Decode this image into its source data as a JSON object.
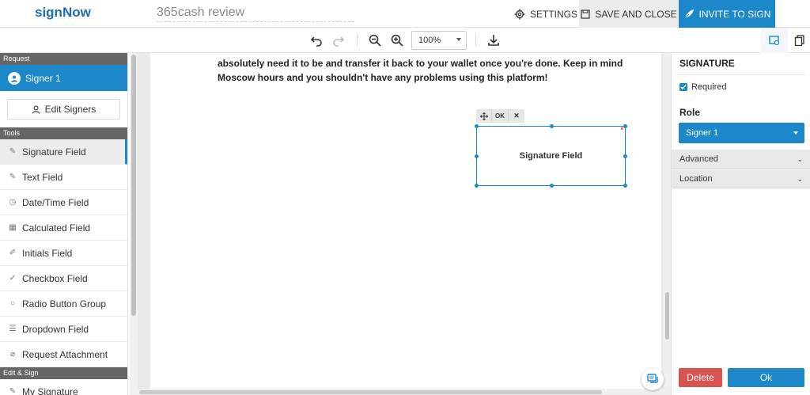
{
  "app": {
    "logo": "signNow",
    "document_title": "365cash review"
  },
  "header": {
    "settings_label": "SETTINGS",
    "save_label": "SAVE AND CLOSE",
    "invite_label": "INVITE TO SIGN"
  },
  "toolbar": {
    "zoom_value": "100%"
  },
  "sidebar": {
    "request_heading": "Request",
    "signer_name": "Signer 1",
    "edit_signers_label": "Edit Signers",
    "tools_heading": "Tools",
    "tools": [
      {
        "label": "Signature Field",
        "icon": "pen-icon"
      },
      {
        "label": "Text Field",
        "icon": "text-pen-icon"
      },
      {
        "label": "Date/Time Field",
        "icon": "clock-icon"
      },
      {
        "label": "Calculated Field",
        "icon": "calculator-icon"
      },
      {
        "label": "Initials Field",
        "icon": "initials-pen-icon"
      },
      {
        "label": "Checkbox Field",
        "icon": "check-icon"
      },
      {
        "label": "Radio Button Group",
        "icon": "radio-icon"
      },
      {
        "label": "Dropdown Field",
        "icon": "list-icon"
      },
      {
        "label": "Request Attachment",
        "icon": "paperclip-icon"
      }
    ],
    "edit_sign_heading": "Edit & Sign",
    "my_signature_label": "My Signature"
  },
  "document": {
    "text": "absolutely need it to be and transfer it back to your wallet once you're done. Keep in mind Moscow hours and you shouldn't have any problems using this platform!",
    "field_ok_label": "OK",
    "field_close_label": "✕",
    "signature_field_label": "Signature Field",
    "required_marker": "*"
  },
  "right_panel": {
    "title": "SIGNATURE",
    "required_label": "Required",
    "required_checked": true,
    "role_label": "Role",
    "role_value": "Signer 1",
    "advanced_label": "Advanced",
    "location_label": "Location",
    "delete_label": "Delete",
    "ok_label": "Ok"
  },
  "colors": {
    "accent": "#1d88c9",
    "danger": "#d9534f",
    "logo": "#1a6fb3"
  }
}
